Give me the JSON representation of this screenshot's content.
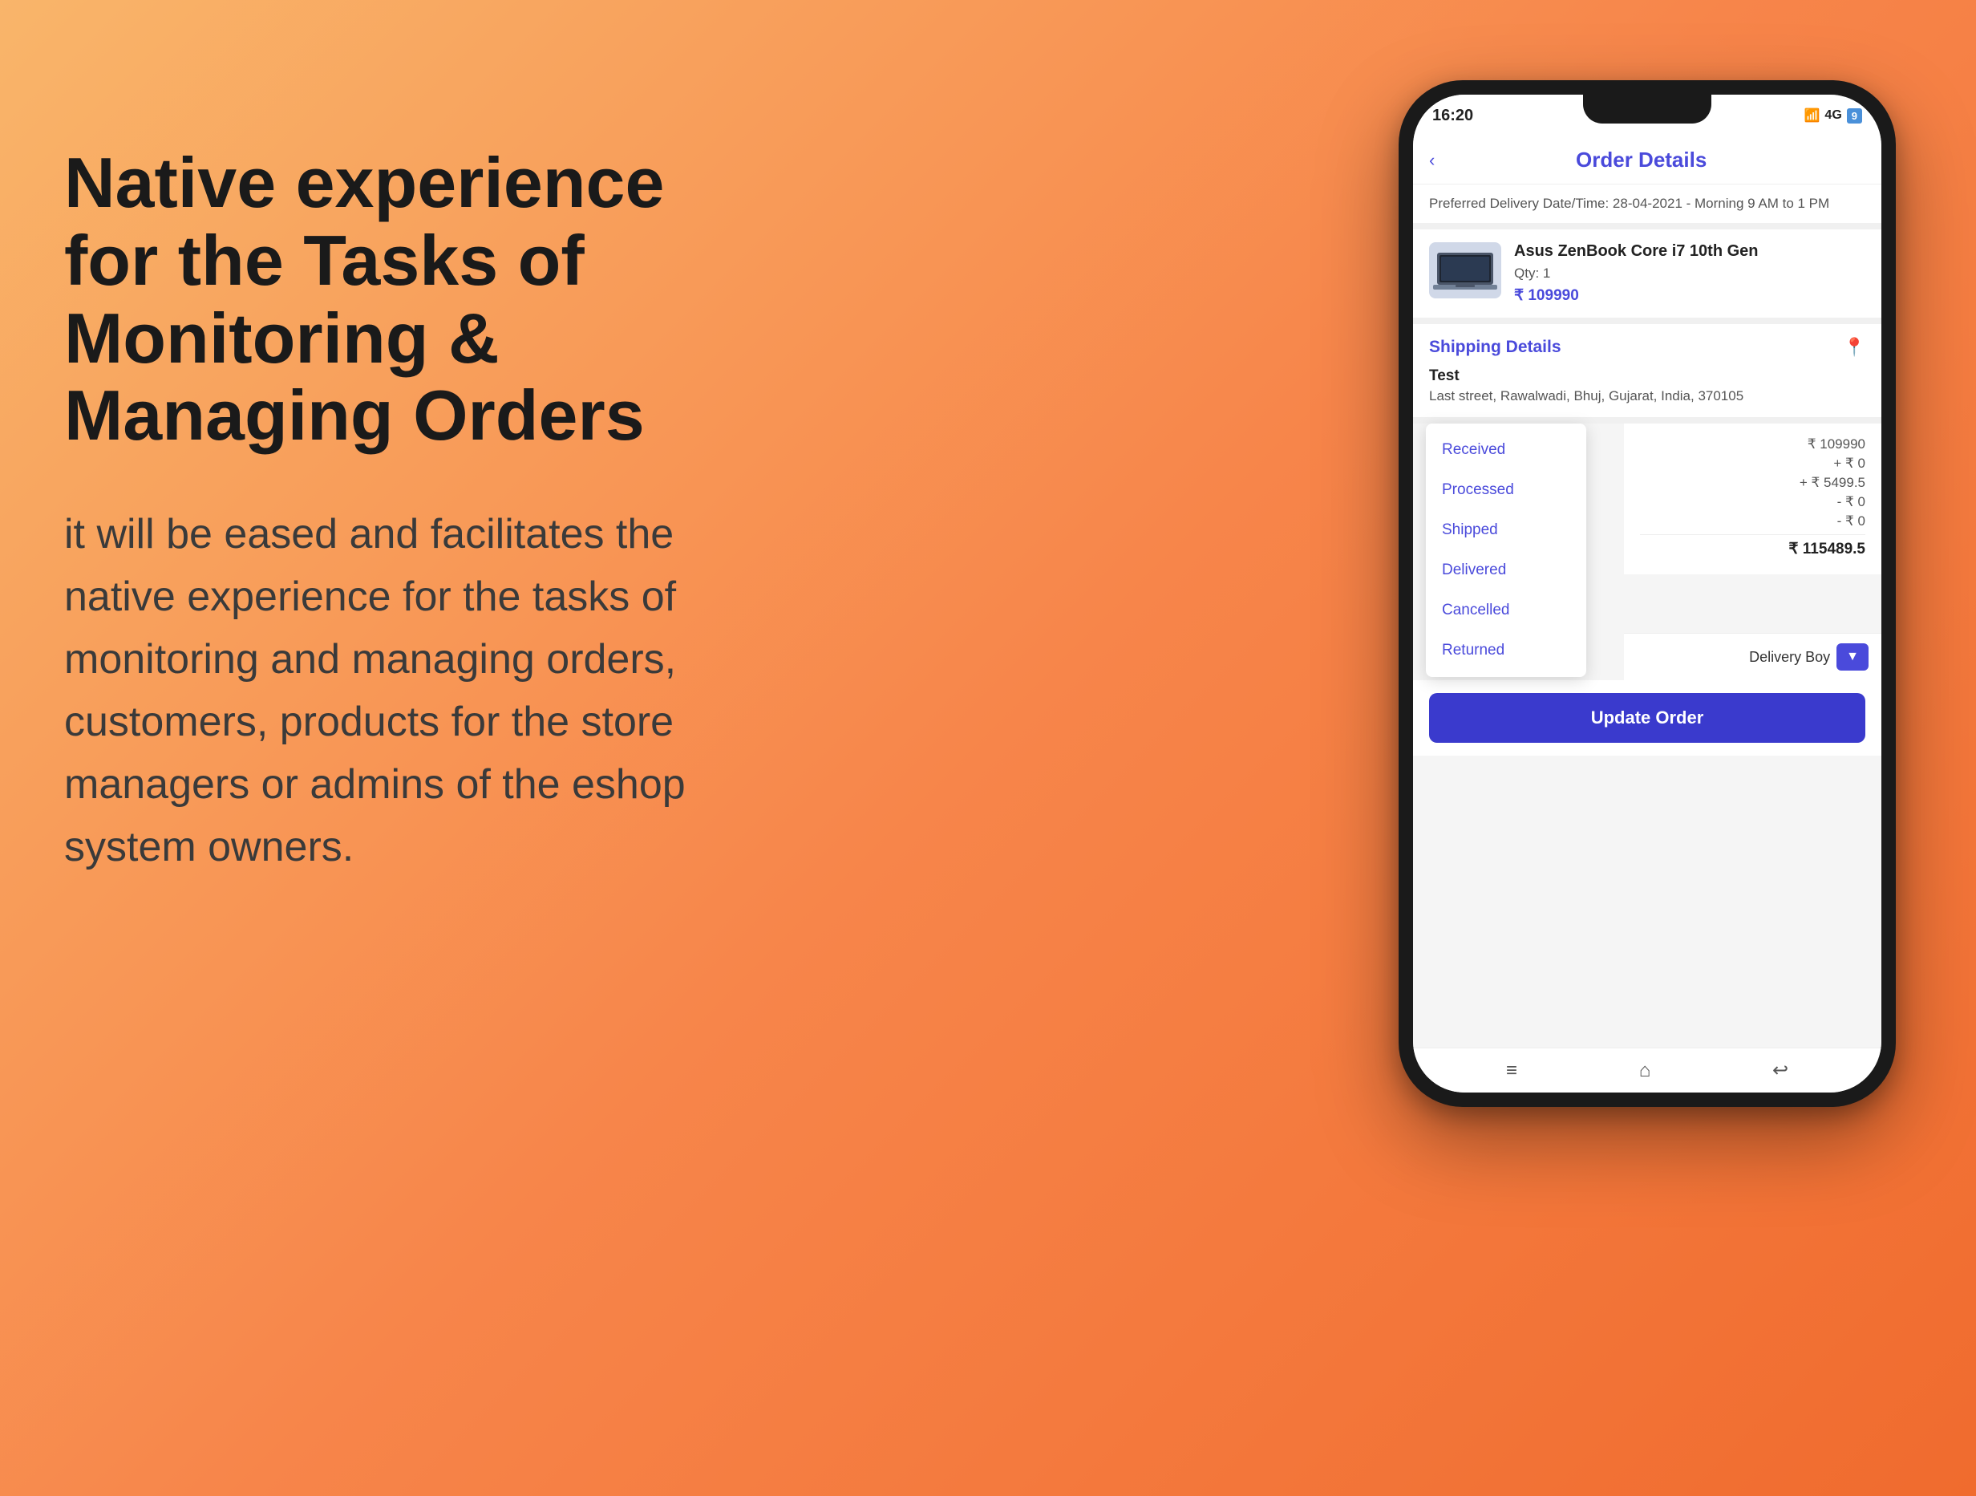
{
  "left": {
    "headline": "Native experience for the Tasks of Monitoring & Managing Orders",
    "body": "it will be eased and facilitates the native experience for the tasks of monitoring and managing orders, customers, products for the store managers or admins of the eshop system owners."
  },
  "phone": {
    "status_bar": {
      "time": "16:20",
      "signal": "4G",
      "battery": "9"
    },
    "header": {
      "back": "‹",
      "title": "Order Details"
    },
    "delivery_banner": "Preferred Delivery Date/Time: 28-04-2021 - Morning 9 AM to 1 PM",
    "product": {
      "name": "Asus ZenBook Core i7 10th Gen",
      "qty": "Qty: 1",
      "price": "₹ 109990"
    },
    "shipping": {
      "title": "Shipping Details",
      "name": "Test",
      "address": "Last street, Rawalwadi, Bhuj, Gujarat, India, 370105"
    },
    "dropdown": {
      "items": [
        "Received",
        "Processed",
        "Shipped",
        "Delivered",
        "Cancelled",
        "Returned"
      ]
    },
    "price_summary": {
      "rows": [
        {
          "label": "",
          "value": "₹ 109990"
        },
        {
          "label": "",
          "value": "+ ₹ 0"
        },
        {
          "label": "",
          "value": "+ ₹ 5499.5"
        },
        {
          "label": "",
          "value": "- ₹ 0"
        },
        {
          "label": "",
          "value": "- ₹ 0"
        }
      ],
      "total": "₹ 115489.5"
    },
    "delivery_boy": {
      "label": "Delivery Boy",
      "btn_arrow": "▼"
    },
    "update_btn": "Update Order",
    "nav": {
      "menu": "≡",
      "home": "⌂",
      "back": "↩"
    }
  }
}
